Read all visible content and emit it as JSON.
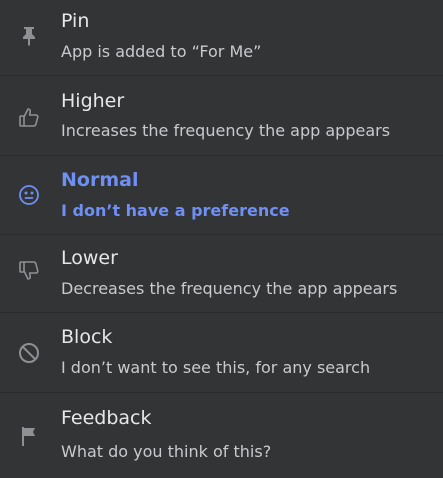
{
  "menu": {
    "items": [
      {
        "id": "pin",
        "title": "Pin",
        "desc": "App is added to “For Me”",
        "icon": "pin-icon",
        "selected": false
      },
      {
        "id": "higher",
        "title": "Higher",
        "desc": "Increases the frequency the app appears",
        "icon": "thumbs-up-icon",
        "selected": false
      },
      {
        "id": "normal",
        "title": "Normal",
        "desc": "I don’t have a preference",
        "icon": "neutral-face-icon",
        "selected": true
      },
      {
        "id": "lower",
        "title": "Lower",
        "desc": "Decreases the frequency the app appears",
        "icon": "thumbs-down-icon",
        "selected": false
      },
      {
        "id": "block",
        "title": "Block",
        "desc": "I don’t want to see this, for any search",
        "icon": "block-icon",
        "selected": false
      },
      {
        "id": "feedback",
        "title": "Feedback",
        "desc": "What do you think of this?",
        "icon": "flag-icon",
        "selected": false
      }
    ]
  },
  "colors": {
    "background": "#333436",
    "divider": "#2a2b2d",
    "text_primary": "#e6e7e9",
    "text_secondary": "#c9cacd",
    "icon": "#8f9093",
    "accent": "#6f8ff2"
  }
}
